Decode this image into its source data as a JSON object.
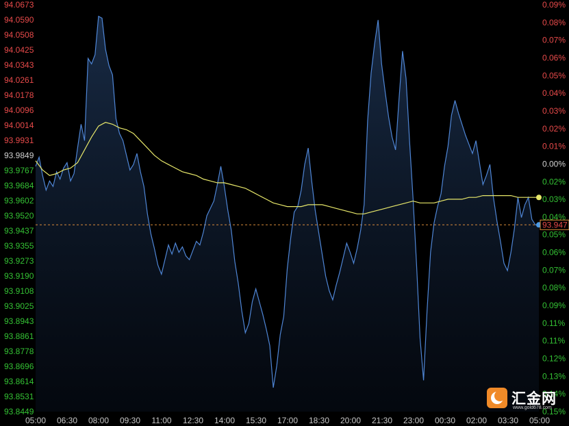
{
  "chart_data": {
    "type": "line",
    "left_axis_labels": [
      "94.0673",
      "94.0590",
      "94.0508",
      "94.0425",
      "94.0343",
      "94.0261",
      "94.0178",
      "94.0096",
      "94.0014",
      "93.9931",
      "93.9849",
      "93.9767",
      "93.9684",
      "93.9602",
      "93.9520",
      "93.9437",
      "93.9355",
      "93.9273",
      "93.9190",
      "93.9108",
      "93.9025",
      "93.8943",
      "93.8861",
      "93.8778",
      "93.8696",
      "93.8614",
      "93.8531",
      "93.8449"
    ],
    "right_axis_labels": [
      "0.09%",
      "0.08%",
      "0.07%",
      "0.06%",
      "0.05%",
      "0.04%",
      "0.03%",
      "0.02%",
      "0.01%",
      "0.00%",
      "0.02%",
      "0.03%",
      "0.04%",
      "0.05%",
      "0.06%",
      "0.07%",
      "0.08%",
      "0.09%",
      "0.11%",
      "0.11%",
      "0.12%",
      "0.13%",
      "0.14%",
      "0.15%"
    ],
    "x_labels": [
      "05:00",
      "06:30",
      "08:00",
      "09:30",
      "11:00",
      "12:30",
      "14:00",
      "15:30",
      "17:00",
      "18:30",
      "20:00",
      "21:30",
      "23:00",
      "00:30",
      "02:00",
      "03:30",
      "05:00"
    ],
    "ylim": [
      93.8449,
      94.0673
    ],
    "reference_price": 93.9849,
    "x_slots": 1440,
    "price_series_name": "",
    "price_points": [
      [
        0,
        93.979
      ],
      [
        10,
        93.984
      ],
      [
        20,
        93.974
      ],
      [
        30,
        93.966
      ],
      [
        40,
        93.971
      ],
      [
        50,
        93.968
      ],
      [
        60,
        93.976
      ],
      [
        70,
        93.972
      ],
      [
        80,
        93.978
      ],
      [
        90,
        93.981
      ],
      [
        100,
        93.971
      ],
      [
        110,
        93.975
      ],
      [
        120,
        93.989
      ],
      [
        130,
        94.002
      ],
      [
        140,
        93.993
      ],
      [
        150,
        94.038
      ],
      [
        160,
        94.035
      ],
      [
        170,
        94.04
      ],
      [
        180,
        94.061
      ],
      [
        190,
        94.06
      ],
      [
        200,
        94.043
      ],
      [
        210,
        94.034
      ],
      [
        220,
        94.029
      ],
      [
        230,
        94.005
      ],
      [
        240,
        93.997
      ],
      [
        250,
        93.993
      ],
      [
        260,
        93.985
      ],
      [
        270,
        93.977
      ],
      [
        280,
        93.98
      ],
      [
        290,
        93.986
      ],
      [
        300,
        93.976
      ],
      [
        310,
        93.968
      ],
      [
        320,
        93.953
      ],
      [
        330,
        93.942
      ],
      [
        340,
        93.934
      ],
      [
        350,
        93.925
      ],
      [
        360,
        93.92
      ],
      [
        370,
        93.928
      ],
      [
        380,
        93.936
      ],
      [
        390,
        93.931
      ],
      [
        400,
        93.937
      ],
      [
        410,
        93.932
      ],
      [
        420,
        93.935
      ],
      [
        430,
        93.93
      ],
      [
        440,
        93.928
      ],
      [
        450,
        93.933
      ],
      [
        460,
        93.938
      ],
      [
        470,
        93.936
      ],
      [
        480,
        93.943
      ],
      [
        490,
        93.952
      ],
      [
        500,
        93.956
      ],
      [
        510,
        93.96
      ],
      [
        520,
        93.969
      ],
      [
        530,
        93.979
      ],
      [
        540,
        93.968
      ],
      [
        550,
        93.955
      ],
      [
        560,
        93.944
      ],
      [
        570,
        93.927
      ],
      [
        580,
        93.915
      ],
      [
        590,
        93.9
      ],
      [
        600,
        93.888
      ],
      [
        610,
        93.893
      ],
      [
        620,
        93.905
      ],
      [
        630,
        93.912
      ],
      [
        640,
        93.905
      ],
      [
        650,
        93.898
      ],
      [
        660,
        93.89
      ],
      [
        670,
        93.881
      ],
      [
        680,
        93.858
      ],
      [
        690,
        93.87
      ],
      [
        700,
        93.887
      ],
      [
        710,
        93.897
      ],
      [
        720,
        93.923
      ],
      [
        730,
        93.94
      ],
      [
        740,
        93.954
      ],
      [
        750,
        93.957
      ],
      [
        760,
        93.966
      ],
      [
        770,
        93.98
      ],
      [
        780,
        93.989
      ],
      [
        790,
        93.971
      ],
      [
        800,
        93.955
      ],
      [
        810,
        93.943
      ],
      [
        820,
        93.931
      ],
      [
        830,
        93.919
      ],
      [
        840,
        93.911
      ],
      [
        850,
        93.906
      ],
      [
        860,
        93.914
      ],
      [
        870,
        93.921
      ],
      [
        880,
        93.929
      ],
      [
        890,
        93.937
      ],
      [
        900,
        93.932
      ],
      [
        910,
        93.926
      ],
      [
        920,
        93.934
      ],
      [
        930,
        93.944
      ],
      [
        940,
        93.958
      ],
      [
        950,
        94.004
      ],
      [
        960,
        94.03
      ],
      [
        970,
        94.046
      ],
      [
        980,
        94.059
      ],
      [
        990,
        94.035
      ],
      [
        1000,
        94.02
      ],
      [
        1010,
        94.006
      ],
      [
        1020,
        93.995
      ],
      [
        1030,
        93.988
      ],
      [
        1040,
        94.016
      ],
      [
        1050,
        94.042
      ],
      [
        1060,
        94.027
      ],
      [
        1070,
        93.993
      ],
      [
        1080,
        93.961
      ],
      [
        1090,
        93.925
      ],
      [
        1100,
        93.885
      ],
      [
        1110,
        93.862
      ],
      [
        1120,
        93.9
      ],
      [
        1130,
        93.932
      ],
      [
        1140,
        93.948
      ],
      [
        1150,
        93.957
      ],
      [
        1160,
        93.964
      ],
      [
        1170,
        93.979
      ],
      [
        1180,
        93.99
      ],
      [
        1190,
        94.007
      ],
      [
        1200,
        94.015
      ],
      [
        1210,
        94.008
      ],
      [
        1220,
        94.002
      ],
      [
        1230,
        93.996
      ],
      [
        1240,
        93.991
      ],
      [
        1250,
        93.986
      ],
      [
        1260,
        93.993
      ],
      [
        1270,
        93.981
      ],
      [
        1280,
        93.969
      ],
      [
        1290,
        93.974
      ],
      [
        1300,
        93.98
      ],
      [
        1310,
        93.962
      ],
      [
        1320,
        93.949
      ],
      [
        1330,
        93.938
      ],
      [
        1340,
        93.926
      ],
      [
        1350,
        93.922
      ],
      [
        1360,
        93.932
      ],
      [
        1370,
        93.945
      ],
      [
        1380,
        93.962
      ],
      [
        1390,
        93.951
      ],
      [
        1400,
        93.958
      ],
      [
        1410,
        93.962
      ],
      [
        1420,
        93.95
      ],
      [
        1430,
        93.947
      ],
      [
        1440,
        93.947
      ]
    ],
    "avg_series_name": "",
    "avg_points": [
      [
        0,
        93.982
      ],
      [
        20,
        93.977
      ],
      [
        40,
        93.974
      ],
      [
        60,
        93.975
      ],
      [
        80,
        93.977
      ],
      [
        100,
        93.978
      ],
      [
        120,
        93.981
      ],
      [
        140,
        93.988
      ],
      [
        160,
        93.995
      ],
      [
        180,
        94.001
      ],
      [
        200,
        94.003
      ],
      [
        220,
        94.002
      ],
      [
        240,
        94.0
      ],
      [
        260,
        93.999
      ],
      [
        280,
        93.997
      ],
      [
        300,
        93.993
      ],
      [
        320,
        93.989
      ],
      [
        340,
        93.985
      ],
      [
        360,
        93.982
      ],
      [
        380,
        93.98
      ],
      [
        400,
        93.978
      ],
      [
        420,
        93.976
      ],
      [
        440,
        93.975
      ],
      [
        460,
        93.974
      ],
      [
        480,
        93.972
      ],
      [
        500,
        93.971
      ],
      [
        520,
        93.97
      ],
      [
        540,
        93.97
      ],
      [
        560,
        93.969
      ],
      [
        580,
        93.968
      ],
      [
        600,
        93.967
      ],
      [
        620,
        93.965
      ],
      [
        640,
        93.963
      ],
      [
        660,
        93.961
      ],
      [
        680,
        93.959
      ],
      [
        700,
        93.958
      ],
      [
        720,
        93.957
      ],
      [
        740,
        93.957
      ],
      [
        760,
        93.957
      ],
      [
        780,
        93.958
      ],
      [
        800,
        93.958
      ],
      [
        820,
        93.958
      ],
      [
        840,
        93.957
      ],
      [
        860,
        93.956
      ],
      [
        880,
        93.955
      ],
      [
        900,
        93.954
      ],
      [
        920,
        93.953
      ],
      [
        940,
        93.953
      ],
      [
        960,
        93.954
      ],
      [
        980,
        93.955
      ],
      [
        1000,
        93.956
      ],
      [
        1020,
        93.957
      ],
      [
        1040,
        93.958
      ],
      [
        1060,
        93.959
      ],
      [
        1080,
        93.96
      ],
      [
        1100,
        93.959
      ],
      [
        1120,
        93.959
      ],
      [
        1140,
        93.959
      ],
      [
        1160,
        93.96
      ],
      [
        1180,
        93.961
      ],
      [
        1200,
        93.961
      ],
      [
        1220,
        93.961
      ],
      [
        1240,
        93.962
      ],
      [
        1260,
        93.962
      ],
      [
        1280,
        93.963
      ],
      [
        1300,
        93.963
      ],
      [
        1320,
        93.963
      ],
      [
        1340,
        93.963
      ],
      [
        1360,
        93.963
      ],
      [
        1380,
        93.962
      ],
      [
        1400,
        93.962
      ],
      [
        1420,
        93.962
      ],
      [
        1440,
        93.962
      ]
    ],
    "last_price_label": "93.947",
    "grid": false
  },
  "colors": {
    "background": "#000000",
    "price_line": "#4f86d6",
    "avg_line": "#e8e86a",
    "up_label": "#e84a4a",
    "down_label": "#34c234",
    "neutral_label": "#d0d0d0",
    "axis_label": "#c8c8c8",
    "last_price_marker": "#4a9ae6",
    "ref_dashed": "#d98c3a"
  },
  "watermark": {
    "brand": "汇金网",
    "url": "www.gold678.com",
    "icon": "crescent-logo-icon"
  }
}
